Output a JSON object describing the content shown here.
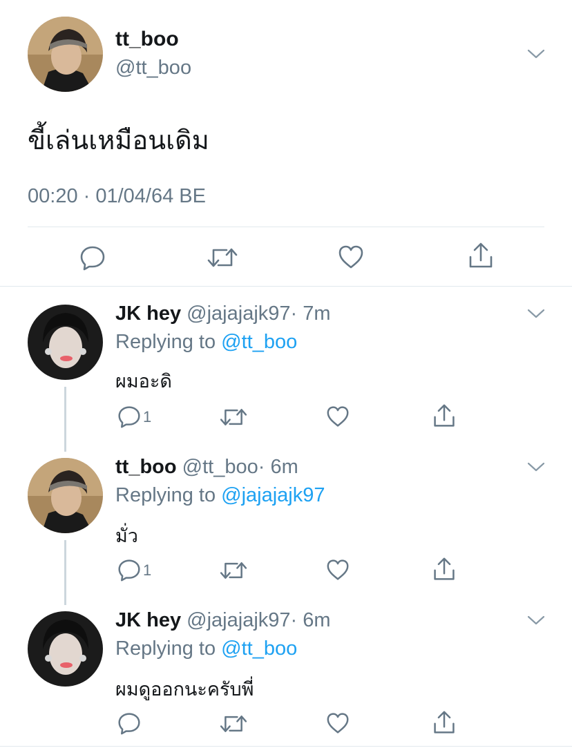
{
  "main_tweet": {
    "display_name": "tt_boo",
    "handle": "@tt_boo",
    "text": "ขี้เล่นเหมือนเดิม",
    "timestamp": "00:20 · 01/04/64 BE"
  },
  "replies": [
    {
      "display_name": "JK hey",
      "handle": "@jajajajk97",
      "time": "· 7m",
      "replying_prefix": "Replying to",
      "replying_to": "@tt_boo",
      "text": "ผมอะดิ",
      "reply_count": "1"
    },
    {
      "display_name": "tt_boo",
      "handle": "@tt_boo",
      "time": "· 6m",
      "replying_prefix": "Replying to",
      "replying_to": "@jajajajk97",
      "text": "มั่ว",
      "reply_count": "1"
    },
    {
      "display_name": "JK hey",
      "handle": "@jajajajk97",
      "time": "· 6m",
      "replying_prefix": "Replying to",
      "replying_to": "@tt_boo",
      "text": "ผมดูออกนะครับพี่",
      "reply_count": ""
    }
  ],
  "icons": {
    "reply": "reply-icon",
    "retweet": "retweet-icon",
    "like": "heart-icon",
    "share": "share-icon",
    "more": "chevron-down-icon"
  },
  "colors": {
    "link": "#1da1f2",
    "muted": "#657786",
    "divider": "#e1e8ed"
  }
}
